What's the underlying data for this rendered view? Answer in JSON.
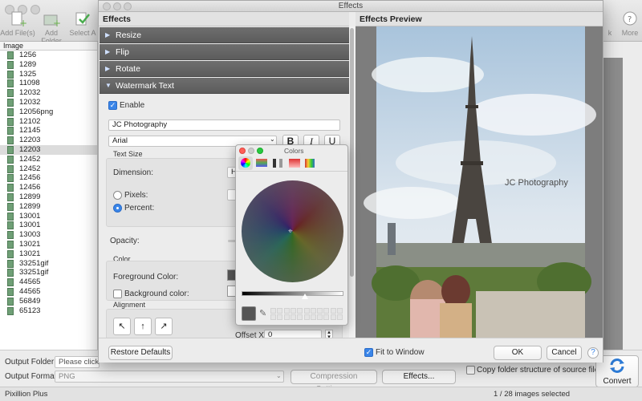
{
  "app": {
    "toolbar": {
      "add_files": "Add File(s)",
      "add_folder": "Add Folder",
      "select_all": "Select A",
      "buttons_right_1": "k",
      "buttons_right_2": "More"
    },
    "list_header": "Image",
    "files": [
      "1256",
      "1289",
      "1325",
      "11098",
      "12032",
      "12032",
      "12056png",
      "12102",
      "12145",
      "12203",
      "12203",
      "12452",
      "12452",
      "12456",
      "12456",
      "12899",
      "12899",
      "13001",
      "13001",
      "13003",
      "13021",
      "13021",
      "33251gif",
      "33251gif",
      "44565",
      "44565",
      "56849",
      "65123"
    ],
    "selected_file_index": 10,
    "output_folder_label": "Output Folder:",
    "output_folder_value": "Please click Br",
    "output_format_label": "Output Format:",
    "output_format_value": "PNG",
    "compression_button": "Compression Settings...",
    "effects_button": "Effects...",
    "copy_structure_label": "Copy folder structure of source files",
    "convert_button": "Convert",
    "status_left": "Pixillion Plus",
    "status_center": "1 / 28 images selected"
  },
  "dialog": {
    "title": "Effects",
    "effects_header": "Effects",
    "preview_header": "Effects Preview",
    "sections": [
      "Resize",
      "Flip",
      "Rotate",
      "Watermark Text"
    ],
    "enable_label": "Enable",
    "enable_checked": true,
    "watermark_text": "JC Photography",
    "font_value": "Arial",
    "bold": "B",
    "italic": "I",
    "underline": "U",
    "text_size_group": "Text Size",
    "dimension_label": "Dimension:",
    "dimension_value": "H",
    "pixels_label": "Pixels:",
    "percent_label": "Percent:",
    "percent_selected": true,
    "opacity_label": "Opacity:",
    "color_group": "Color",
    "foreground_label": "Foreground Color:",
    "background_label": "Background color:",
    "alignment_group": "Alignment",
    "offset_x_label": "Offset X:",
    "offset_x_value": "0",
    "restore_button": "Restore Defaults",
    "fit_label": "Fit to Window",
    "fit_checked": true,
    "ok_button": "OK",
    "cancel_button": "Cancel",
    "help_button": "?",
    "preview_watermark": "JC Photography"
  },
  "colors_panel": {
    "title": "Colors",
    "current_color": "#555555",
    "accent": "#3a85e8"
  }
}
